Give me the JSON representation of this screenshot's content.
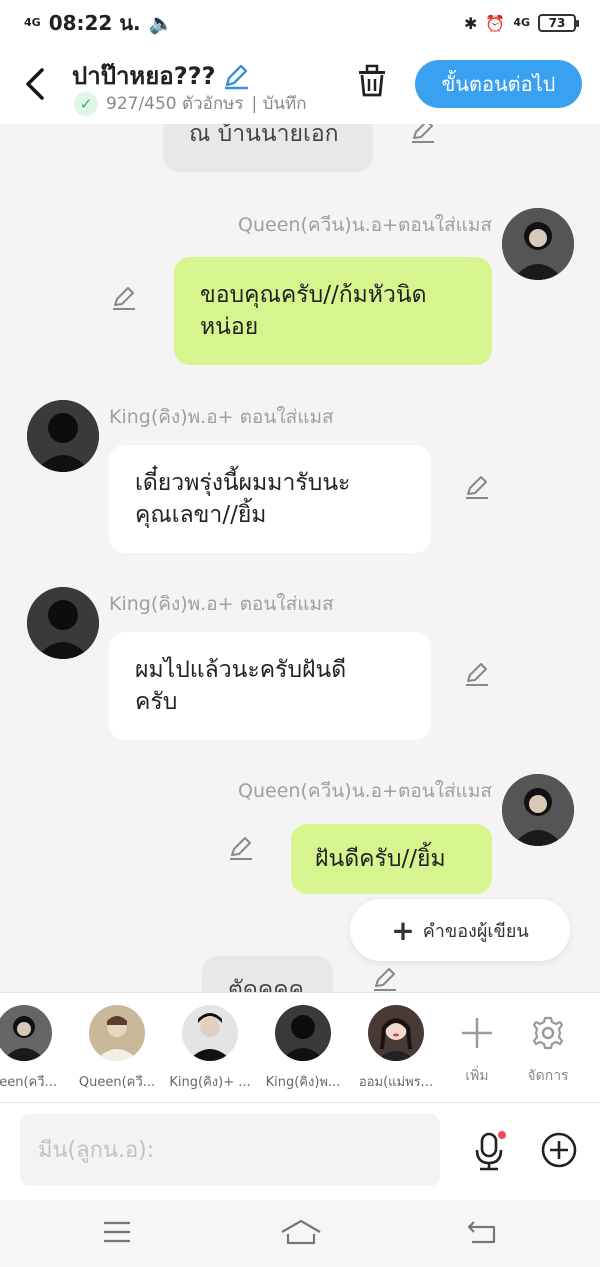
{
  "status": {
    "network_left": "4G",
    "time": "08:22 น.",
    "network_right": "4G",
    "battery": "73"
  },
  "header": {
    "title": "ปาป๊าหยอ???",
    "char_count": "927/450 ตัวอักษร",
    "saved_label": "| บันทึก",
    "next_button": "ขั้นตอนต่อไป"
  },
  "chat": {
    "top_partial": "ณ  บ้านนายเอก",
    "messages": [
      {
        "side": "right",
        "name": "Queen(ควีน)น.อ+ตอนใส่แมส",
        "text_line1": "ขอบคุณครับ//ก้มหัวนิด",
        "text_line2": "หน่อย"
      },
      {
        "side": "left",
        "name": "King(คิง)พ.อ+ ตอนใส่แมส",
        "text_line1": "เดี๋ยวพรุ่งนี้ผมมารับนะ",
        "text_line2": "คุณเลขา//ยิ้ม"
      },
      {
        "side": "left",
        "name": "King(คิง)พ.อ+ ตอนใส่แมส",
        "text_line1": "ผมไปแล้วนะครับฝันดี",
        "text_line2": "ครับ"
      },
      {
        "side": "right",
        "name": "Queen(ควีน)น.อ+ตอนใส่แมส",
        "text_line1": "ฝันดีครับ//ยิ้ม",
        "text_line2": ""
      }
    ],
    "bottom_partial": "ตัดคคค",
    "author_button": "คำของผู้เขียน"
  },
  "characters": [
    {
      "name": "ueen(ควี..."
    },
    {
      "name": "Queen(ควี..."
    },
    {
      "name": "King(คิง)+ ..."
    },
    {
      "name": "King(คิง)พ..."
    },
    {
      "name": "ออม(แม่พร..."
    }
  ],
  "tools": {
    "add_label": "เพิ่ม",
    "manage_label": "จัดการ"
  },
  "input": {
    "placeholder": "มีน(ลูกน.อ):"
  },
  "colors": {
    "accent": "#3aa0f0",
    "green_bubble": "#d6f58e",
    "bg": "#f4f4f4"
  }
}
